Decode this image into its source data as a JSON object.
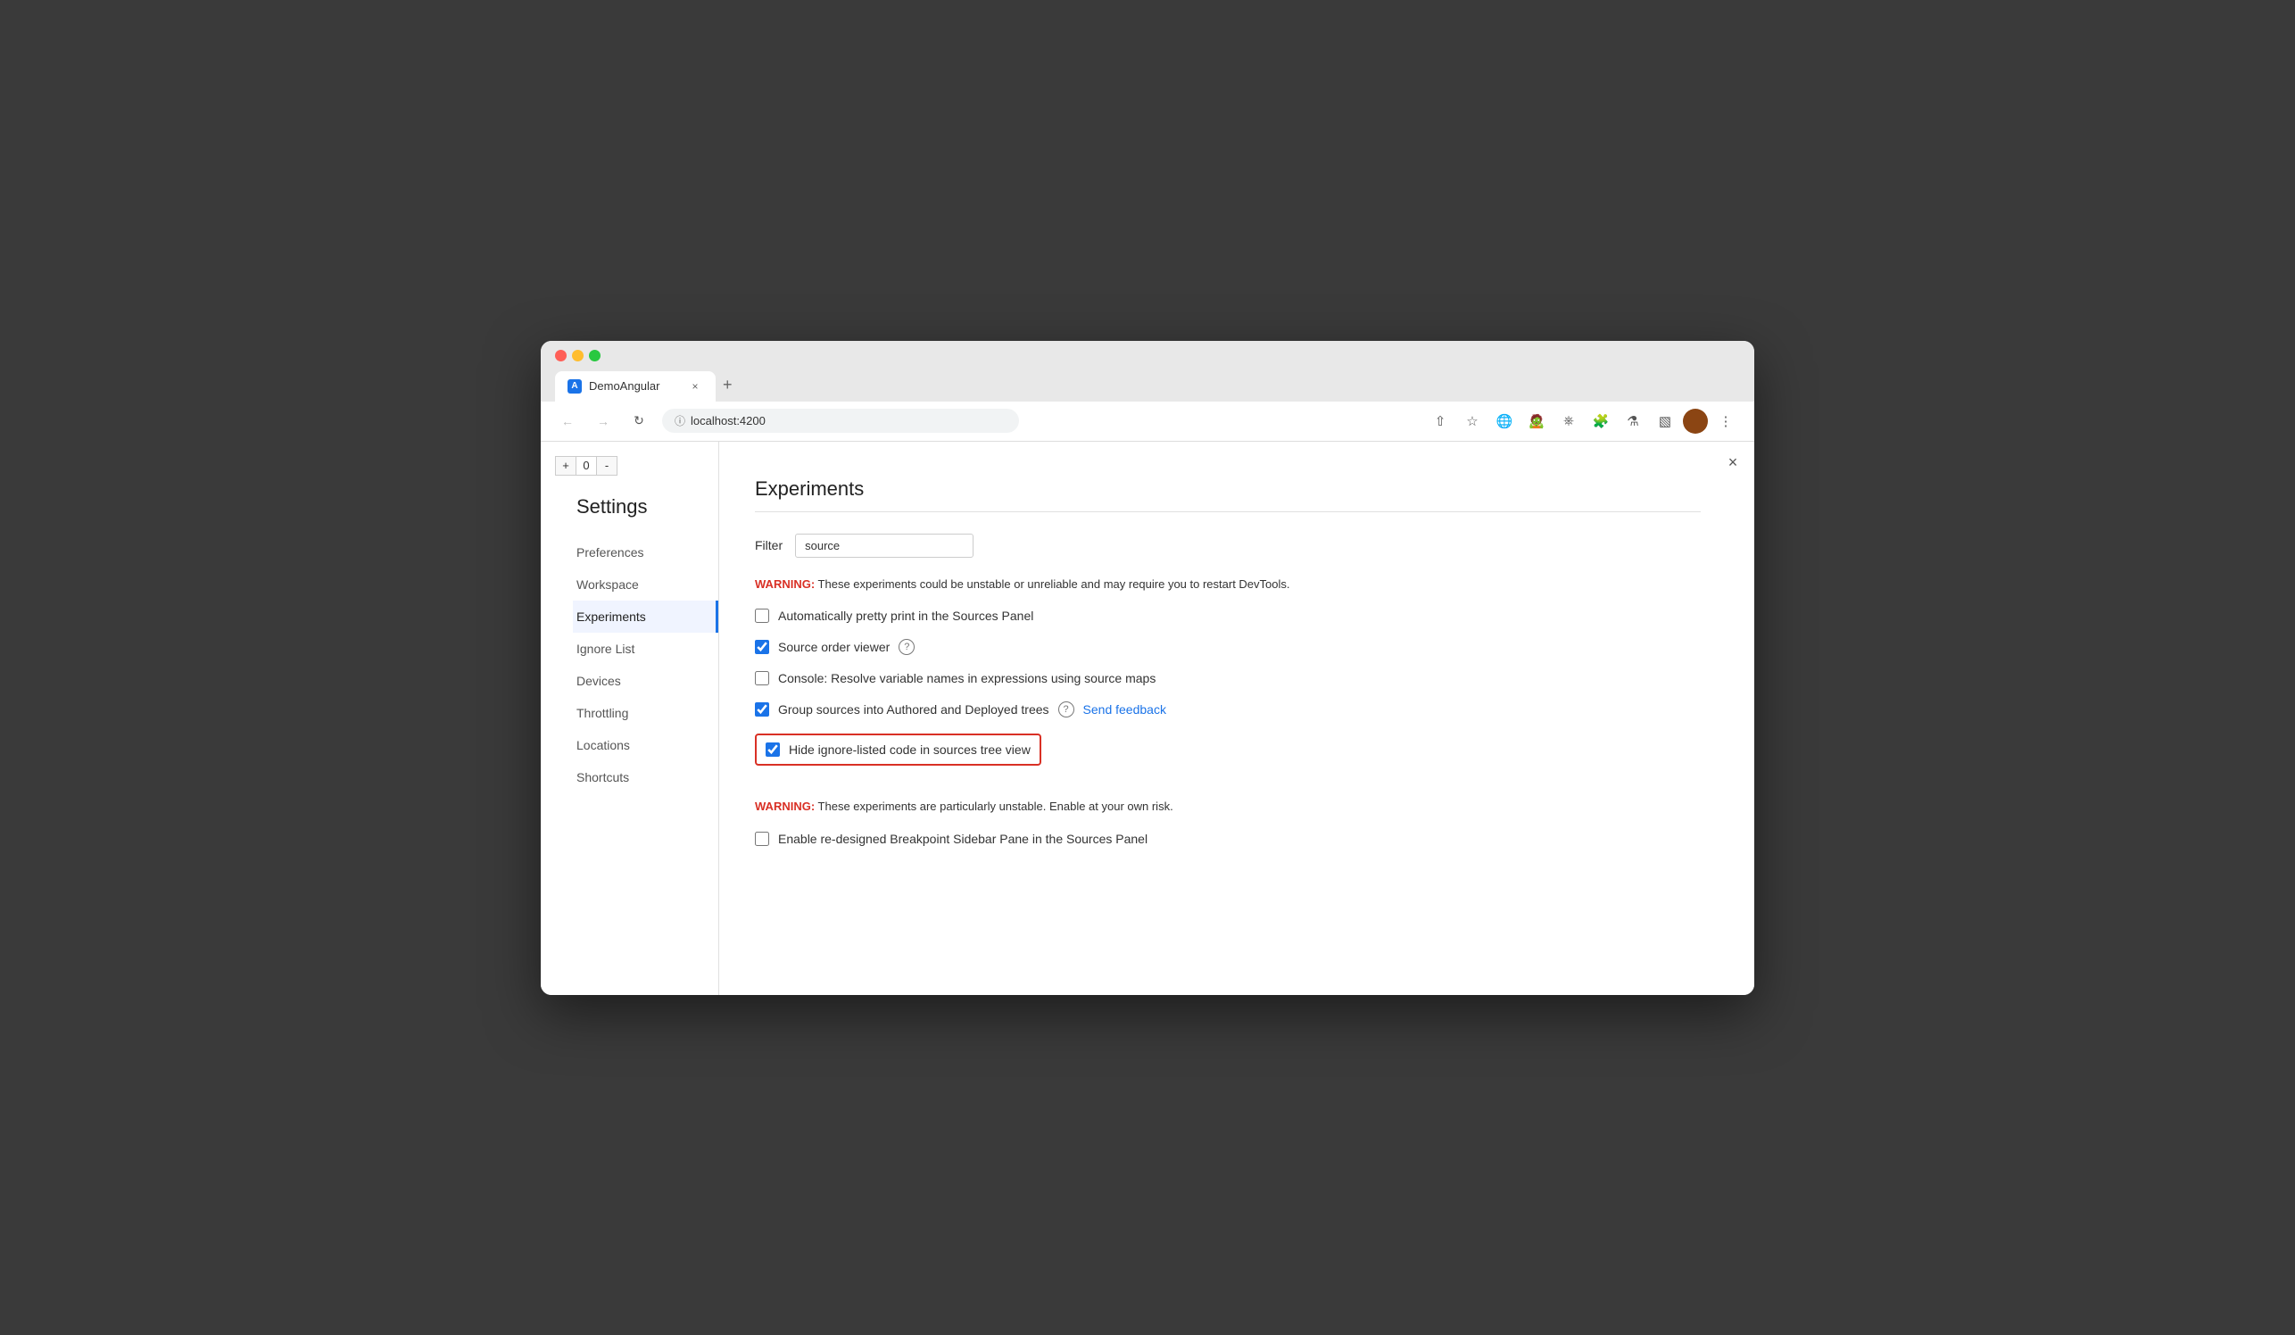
{
  "browser": {
    "tab_title": "DemoAngular",
    "tab_icon": "A",
    "url": "localhost:4200",
    "close_label": "×",
    "new_tab_label": "+"
  },
  "devtools_counter": {
    "plus": "+",
    "value": "0",
    "minus": "-"
  },
  "panel_close": "×",
  "settings": {
    "title": "Settings",
    "sidebar_items": [
      {
        "label": "Preferences",
        "active": false
      },
      {
        "label": "Workspace",
        "active": false
      },
      {
        "label": "Experiments",
        "active": true
      },
      {
        "label": "Ignore List",
        "active": false
      },
      {
        "label": "Devices",
        "active": false
      },
      {
        "label": "Throttling",
        "active": false
      },
      {
        "label": "Locations",
        "active": false
      },
      {
        "label": "Shortcuts",
        "active": false
      }
    ]
  },
  "experiments": {
    "title": "Experiments",
    "filter_label": "Filter",
    "filter_value": "source",
    "warning1": {
      "label": "WARNING:",
      "text": " These experiments could be unstable or unreliable and may require you to restart DevTools."
    },
    "items": [
      {
        "id": "auto-pretty-print",
        "label": "Automatically pretty print in the Sources Panel",
        "checked": false,
        "highlighted": false,
        "has_help": false,
        "has_feedback": false
      },
      {
        "id": "source-order-viewer",
        "label": "Source order viewer",
        "checked": true,
        "highlighted": false,
        "has_help": true,
        "has_feedback": false
      },
      {
        "id": "resolve-variable-names",
        "label": "Console: Resolve variable names in expressions using source maps",
        "checked": false,
        "highlighted": false,
        "has_help": false,
        "has_feedback": false
      },
      {
        "id": "group-sources",
        "label": "Group sources into Authored and Deployed trees",
        "checked": true,
        "highlighted": false,
        "has_help": true,
        "has_feedback": true,
        "feedback_label": "Send feedback"
      },
      {
        "id": "hide-ignore-listed",
        "label": "Hide ignore-listed code in sources tree view",
        "checked": true,
        "highlighted": true,
        "has_help": false,
        "has_feedback": false
      }
    ],
    "warning2": {
      "label": "WARNING:",
      "text": " These experiments are particularly unstable. Enable at your own risk."
    },
    "items2": [
      {
        "id": "redesigned-breakpoint",
        "label": "Enable re-designed Breakpoint Sidebar Pane in the Sources Panel",
        "checked": false,
        "highlighted": false,
        "has_help": false,
        "has_feedback": false
      }
    ]
  }
}
